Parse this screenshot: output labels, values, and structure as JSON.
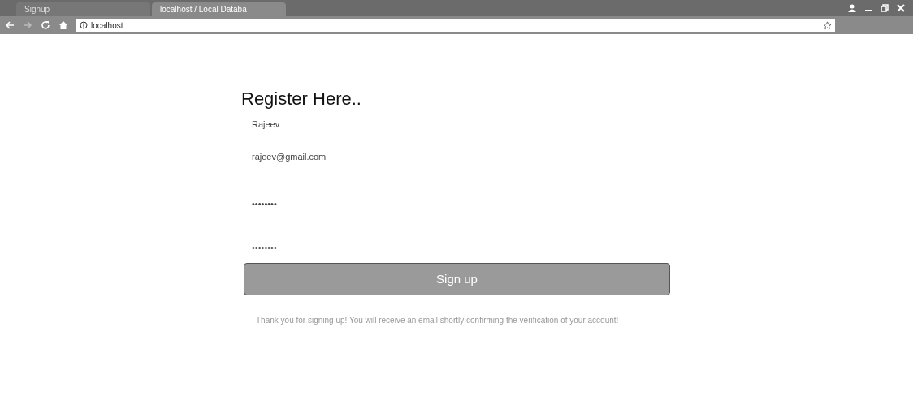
{
  "browser": {
    "tabs": [
      {
        "title": "Signup",
        "selected": false
      },
      {
        "title": "localhost / Local Databa",
        "selected": true
      }
    ],
    "address": "localhost"
  },
  "form": {
    "title": "Register Here..",
    "fields": [
      {
        "value": "Rajeev"
      },
      {
        "value": "rajeev@gmail.com"
      },
      {
        "value": "••••••••"
      },
      {
        "value": "••••••••"
      }
    ],
    "button": "Sign up",
    "message": "Thank you for signing up! You will receive an email shortly confirming the verification of your account!"
  }
}
